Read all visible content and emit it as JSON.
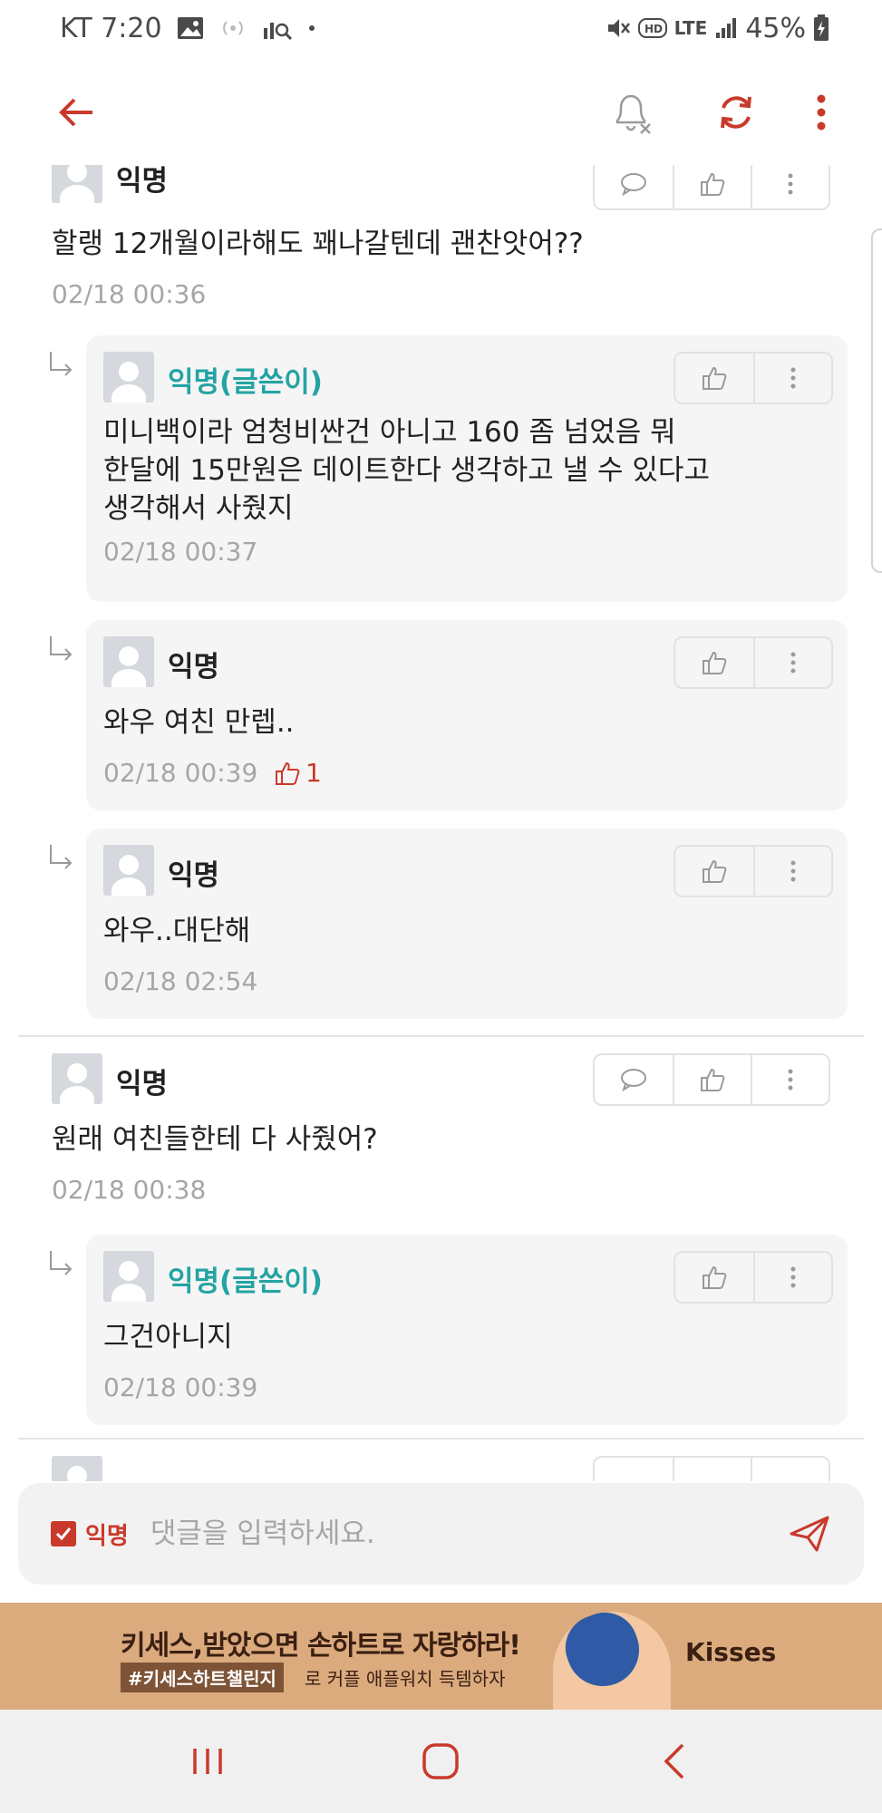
{
  "status_bar": {
    "carrier_time": "KT 7:20",
    "network": "LTE",
    "battery": "45%"
  },
  "colors": {
    "accent": "#c9392b",
    "author": "#24a3a3",
    "timestamp": "#a6a6a6",
    "reply_bg": "#f5f5f5"
  },
  "comments": [
    {
      "name": "익명",
      "text": "할랭 12개월이라해도 꽤나갈텐데 괜찬앗어??",
      "time": "02/18 00:36"
    },
    {
      "name": "익명(글쓴이)",
      "text": "미니백이라 엄청비싼건 아니고 160 좀 넘었음 뭐\n한달에 15만원은 데이트한다 생각하고 낼 수 있다고\n생각해서 사줬지",
      "time": "02/18 00:37"
    },
    {
      "name": "익명",
      "text": "와우 여친 만렙..",
      "time": "02/18 00:39",
      "likes": "1"
    },
    {
      "name": "익명",
      "text": "와우..대단해",
      "time": "02/18 02:54"
    },
    {
      "name": "익명",
      "text": "원래 여친들한테 다 사줬어?",
      "time": "02/18 00:38"
    },
    {
      "name": "익명(글쓴이)",
      "text": "그건아니지",
      "time": "02/18 00:39"
    }
  ],
  "composer": {
    "anon_label": "익명",
    "placeholder": "댓글을 입력하세요."
  },
  "ad": {
    "title": "키세스,받았으면 손하트로 자랑하라!",
    "hashtag": "#키세스하트챌린지",
    "subtitle_rest": "로 커플 애플워치 득템하자",
    "brand": "Kisses"
  },
  "icons": {
    "back": "back-arrow-icon",
    "notify": "bell-off-icon",
    "refresh": "refresh-icon",
    "more": "more-vert-icon",
    "reply": "reply-bubble-icon",
    "like": "thumbs-up-icon",
    "send": "send-icon"
  }
}
